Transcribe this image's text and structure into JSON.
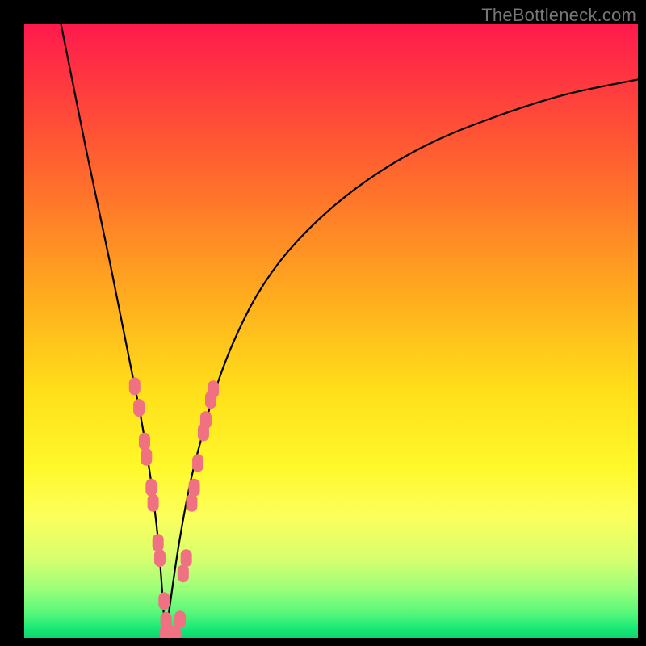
{
  "watermark": "TheBottleneck.com",
  "colors": {
    "frame": "#000000",
    "curve_stroke": "#000000",
    "marker_fill": "#ef7182",
    "marker_stroke": "#c94a5c"
  },
  "chart_data": {
    "type": "line",
    "title": "",
    "xlabel": "",
    "ylabel": "",
    "xlim": [
      0,
      100
    ],
    "ylim": [
      0,
      100
    ],
    "gradient_meaning": "background color maps y-value: high=red (worse), low=green (better)",
    "notch_x": 23,
    "series": [
      {
        "name": "left-branch",
        "x": [
          6,
          8,
          10,
          12,
          14,
          16,
          18,
          19,
          20,
          21,
          22,
          23
        ],
        "values": [
          100,
          90,
          80,
          70.5,
          61,
          51,
          41,
          36,
          30,
          23,
          14,
          0
        ]
      },
      {
        "name": "right-branch",
        "x": [
          23,
          25,
          27,
          29,
          31,
          34,
          38,
          43,
          50,
          58,
          67,
          77,
          88,
          100
        ],
        "values": [
          0,
          14,
          25,
          33,
          40,
          48,
          56,
          63,
          70,
          76,
          81,
          85,
          88.5,
          91
        ]
      }
    ],
    "markers": {
      "name": "highlighted-points",
      "points": [
        {
          "x": 18.0,
          "y": 41.0
        },
        {
          "x": 18.7,
          "y": 37.5
        },
        {
          "x": 19.6,
          "y": 32.0
        },
        {
          "x": 19.9,
          "y": 29.5
        },
        {
          "x": 20.7,
          "y": 24.5
        },
        {
          "x": 21.0,
          "y": 22.0
        },
        {
          "x": 21.8,
          "y": 15.5
        },
        {
          "x": 22.1,
          "y": 13.0
        },
        {
          "x": 22.8,
          "y": 6.0
        },
        {
          "x": 23.1,
          "y": 2.8
        },
        {
          "x": 23.0,
          "y": 0.6
        },
        {
          "x": 23.9,
          "y": 0.6
        },
        {
          "x": 24.6,
          "y": 0.6
        },
        {
          "x": 25.4,
          "y": 3.0
        },
        {
          "x": 25.9,
          "y": 10.5
        },
        {
          "x": 26.4,
          "y": 13.0
        },
        {
          "x": 27.3,
          "y": 22.0
        },
        {
          "x": 27.7,
          "y": 24.5
        },
        {
          "x": 28.3,
          "y": 28.5
        },
        {
          "x": 29.2,
          "y": 33.5
        },
        {
          "x": 29.6,
          "y": 35.5
        },
        {
          "x": 30.4,
          "y": 38.8
        },
        {
          "x": 30.8,
          "y": 40.5
        }
      ]
    }
  }
}
